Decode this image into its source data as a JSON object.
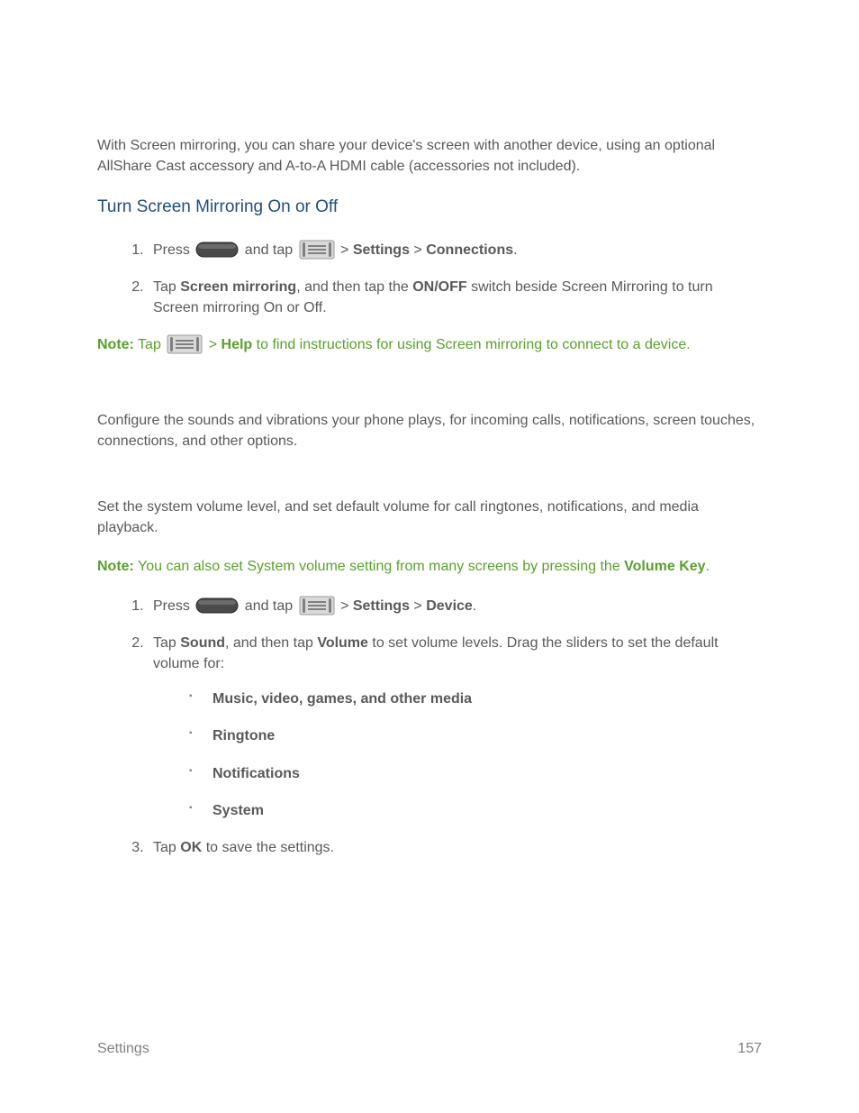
{
  "intro_para": "With Screen mirroring, you can share your device's screen with another device, using an optional AllShare Cast accessory and A-to-A HDMI cable (accessories not included).",
  "heading1": "Turn Screen Mirroring On or Off",
  "step1": {
    "press": "Press ",
    "and_tap": " and tap ",
    "gt1": " > ",
    "settings": "Settings",
    "gt2": " > ",
    "connections": "Connections",
    "period": "."
  },
  "step2": {
    "tap": "Tap ",
    "sm": "Screen mirroring",
    "then": ", and then tap the ",
    "onoff": "ON/OFF",
    "rest": " switch beside Screen Mirroring to turn Screen mirroring On or Off."
  },
  "note1": {
    "label": "Note:",
    "tap": " Tap ",
    "gt": " > ",
    "help": "Help",
    "rest": " to find instructions for using Screen mirroring to connect to a device."
  },
  "para2": "Configure the sounds and vibrations your phone plays, for incoming calls, notifications, screen touches, connections, and other options.",
  "para3": "Set the system volume level, and set default volume for call ringtones, notifications, and media playback.",
  "note2": {
    "label": "Note:",
    "text1": " You can also set System volume setting from many screens by pressing the ",
    "vk": "Volume Key",
    "period": "."
  },
  "step_b1": {
    "press": "Press ",
    "and_tap": " and tap ",
    "gt1": " > ",
    "settings": "Settings",
    "gt2": " > ",
    "device": "Device",
    "period": "."
  },
  "step_b2": {
    "tap": "Tap ",
    "sound": "Sound",
    "then": ", and then tap ",
    "volume": "Volume",
    "rest": " to set volume levels. Drag the sliders to set the default volume for:"
  },
  "bullets": {
    "b1": "Music, video, games, and other media",
    "b2": "Ringtone",
    "b3": "Notifications",
    "b4": "System"
  },
  "step_b3": {
    "tap": "Tap ",
    "ok": "OK",
    "rest": " to save the settings."
  },
  "footer": {
    "left": "Settings",
    "right": "157"
  }
}
